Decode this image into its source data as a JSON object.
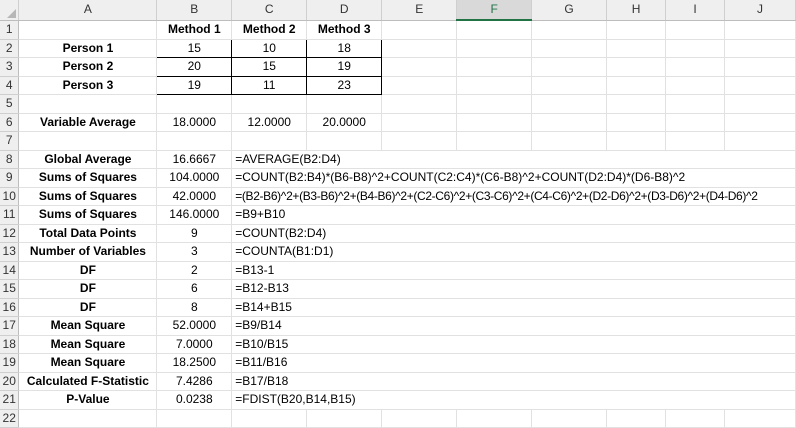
{
  "columns": [
    "A",
    "B",
    "C",
    "D",
    "E",
    "F",
    "G",
    "H",
    "I",
    "J"
  ],
  "selected_column": "F",
  "rows": [
    {
      "n": "1",
      "A": "",
      "B": "Method 1",
      "C": "Method 2",
      "D": "Method 3"
    },
    {
      "n": "2",
      "A": "Person 1",
      "B": "15",
      "C": "10",
      "D": "18"
    },
    {
      "n": "3",
      "A": "Person 2",
      "B": "20",
      "C": "15",
      "D": "19"
    },
    {
      "n": "4",
      "A": "Person 3",
      "B": "19",
      "C": "11",
      "D": "23"
    },
    {
      "n": "5",
      "A": "",
      "B": "",
      "C": ""
    },
    {
      "n": "6",
      "A": "Variable Average",
      "B": "18.0000",
      "C": "12.0000",
      "D": "20.0000"
    },
    {
      "n": "7",
      "A": "",
      "B": "",
      "C": ""
    },
    {
      "n": "8",
      "A": "Global Average",
      "B": "16.6667",
      "C": "=AVERAGE(B2:D4)"
    },
    {
      "n": "9",
      "A": "Sums of Squares",
      "B": "104.0000",
      "C": "=COUNT(B2:B4)*(B6-B8)^2+COUNT(C2:C4)*(C6-B8)^2+COUNT(D2:D4)*(D6-B8)^2"
    },
    {
      "n": "10",
      "A": "Sums of Squares",
      "B": "42.0000",
      "C": "=(B2-B6)^2+(B3-B6)^2+(B4-B6)^2+(C2-C6)^2+(C3-C6)^2+(C4-C6)^2+(D2-D6)^2+(D3-D6)^2+(D4-D6)^2"
    },
    {
      "n": "11",
      "A": "Sums of Squares",
      "B": "146.0000",
      "C": "=B9+B10"
    },
    {
      "n": "12",
      "A": "Total Data Points",
      "B": "9",
      "C": "=COUNT(B2:D4)"
    },
    {
      "n": "13",
      "A": "Number of Variables",
      "B": "3",
      "C": "=COUNTA(B1:D1)"
    },
    {
      "n": "14",
      "A": "DF",
      "B": "2",
      "C": "=B13-1"
    },
    {
      "n": "15",
      "A": "DF",
      "B": "6",
      "C": "=B12-B13"
    },
    {
      "n": "16",
      "A": "DF",
      "B": "8",
      "C": "=B14+B15"
    },
    {
      "n": "17",
      "A": "Mean Square",
      "B": "52.0000",
      "C": "=B9/B14"
    },
    {
      "n": "18",
      "A": "Mean Square",
      "B": "7.0000",
      "C": "=B10/B15"
    },
    {
      "n": "19",
      "A": "Mean Square",
      "B": "18.2500",
      "C": "=B11/B16"
    },
    {
      "n": "20",
      "A": "Calculated F-Statistic",
      "B": "7.4286",
      "C": "=B17/B18"
    },
    {
      "n": "21",
      "A": "P-Value",
      "B": "0.0238",
      "C": "=FDIST(B20,B14,B15)"
    },
    {
      "n": "22",
      "A": "",
      "B": "",
      "C": ""
    }
  ],
  "colors": {
    "header_bg": "#efefef",
    "grid_line": "#e1e1e1",
    "selected_header": "#217346"
  }
}
